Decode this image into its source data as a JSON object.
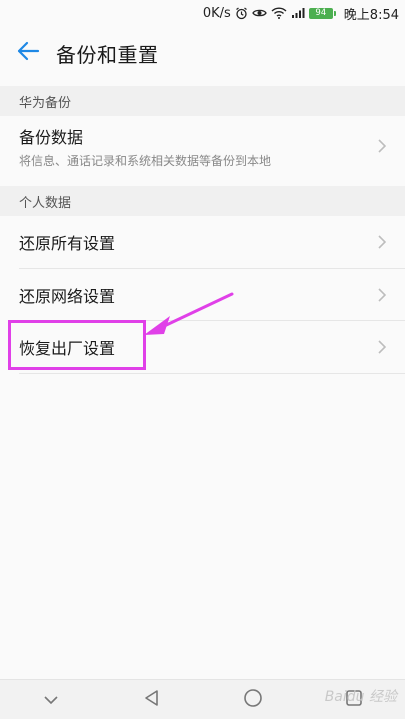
{
  "status_bar": {
    "net_speed": "0K/s",
    "battery": "94",
    "time": "晚上8:54",
    "icons": [
      "alarm-icon",
      "eye-icon",
      "wifi-icon",
      "signal-icon",
      "battery-icon"
    ]
  },
  "header": {
    "title": "备份和重置",
    "back_icon": "arrow-left-icon",
    "accent_color": "#1e88e5"
  },
  "sections": [
    {
      "header": "华为备份",
      "items": [
        {
          "title": "备份数据",
          "subtitle": "将信息、通话记录和系统相关数据等备份到本地"
        }
      ]
    },
    {
      "header": "个人数据",
      "items": [
        {
          "title": "还原所有设置"
        },
        {
          "title": "还原网络设置"
        },
        {
          "title": "恢复出厂设置"
        }
      ]
    }
  ],
  "annotation": {
    "color": "#e040e8",
    "highlighted_item": "恢复出厂设置"
  },
  "nav_bar": {
    "icons": [
      "chevron-down-icon",
      "back-triangle-icon",
      "home-circle-icon",
      "recents-square-icon"
    ]
  },
  "watermark": "Baidu 经验"
}
